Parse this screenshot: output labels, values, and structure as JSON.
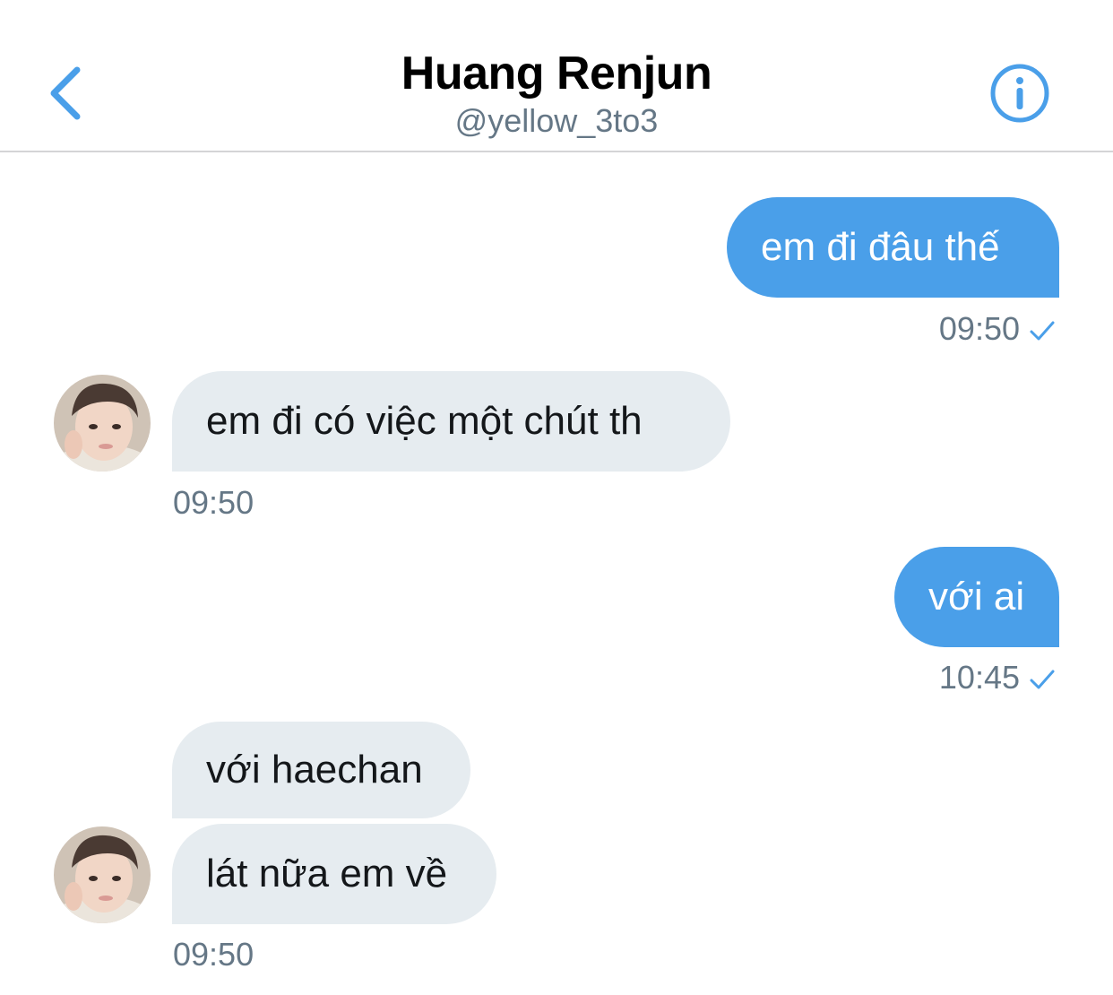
{
  "header": {
    "title": "Huang Renjun",
    "handle": "@yellow_3to3",
    "back_icon": "chevron-left-icon",
    "info_icon": "info-circle-icon"
  },
  "colors": {
    "accent": "#4a9fe9",
    "incoming_bubble": "#e6ecf0",
    "secondary_text": "#657786"
  },
  "messages": [
    {
      "direction": "outgoing",
      "text": "em đi đâu thế",
      "time": "09:50",
      "read_icon": "check-icon"
    },
    {
      "direction": "incoming",
      "text": "em đi có việc một chút th",
      "time": "09:50"
    },
    {
      "direction": "outgoing",
      "text": "với ai",
      "time": "10:45",
      "read_icon": "check-icon"
    },
    {
      "direction": "incoming",
      "text": "với haechan"
    },
    {
      "direction": "incoming",
      "text": "lát nữa em về",
      "time": "09:50"
    }
  ]
}
